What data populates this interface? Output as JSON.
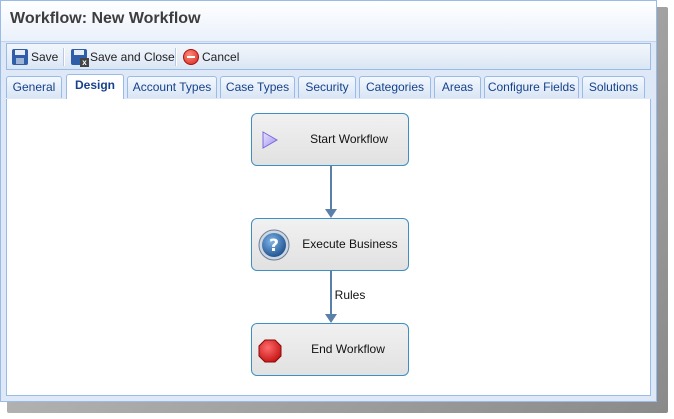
{
  "window": {
    "title": "Workflow: New Workflow"
  },
  "toolbar": {
    "save_label": "Save",
    "save_close_label": "Save and Close",
    "cancel_label": "Cancel"
  },
  "tabs": [
    {
      "label": "General"
    },
    {
      "label": "Design",
      "active": true
    },
    {
      "label": "Account Types"
    },
    {
      "label": "Case Types"
    },
    {
      "label": "Security"
    },
    {
      "label": "Categories"
    },
    {
      "label": "Areas"
    },
    {
      "label": "Configure Fields"
    },
    {
      "label": "Solutions"
    }
  ],
  "workflow": {
    "nodes": [
      {
        "label": "Start Workflow",
        "icon": "play-triangle-icon"
      },
      {
        "label": "Execute Business Rules",
        "icon": "question-mark-icon"
      },
      {
        "label": "End Workflow",
        "icon": "stop-octagon-icon"
      }
    ]
  },
  "colors": {
    "accent_border": "#99bbe8",
    "tab_text": "#15428b",
    "node_border": "#3d8fc4",
    "connector": "#5a7fa8",
    "stop_red": "#d81414"
  }
}
